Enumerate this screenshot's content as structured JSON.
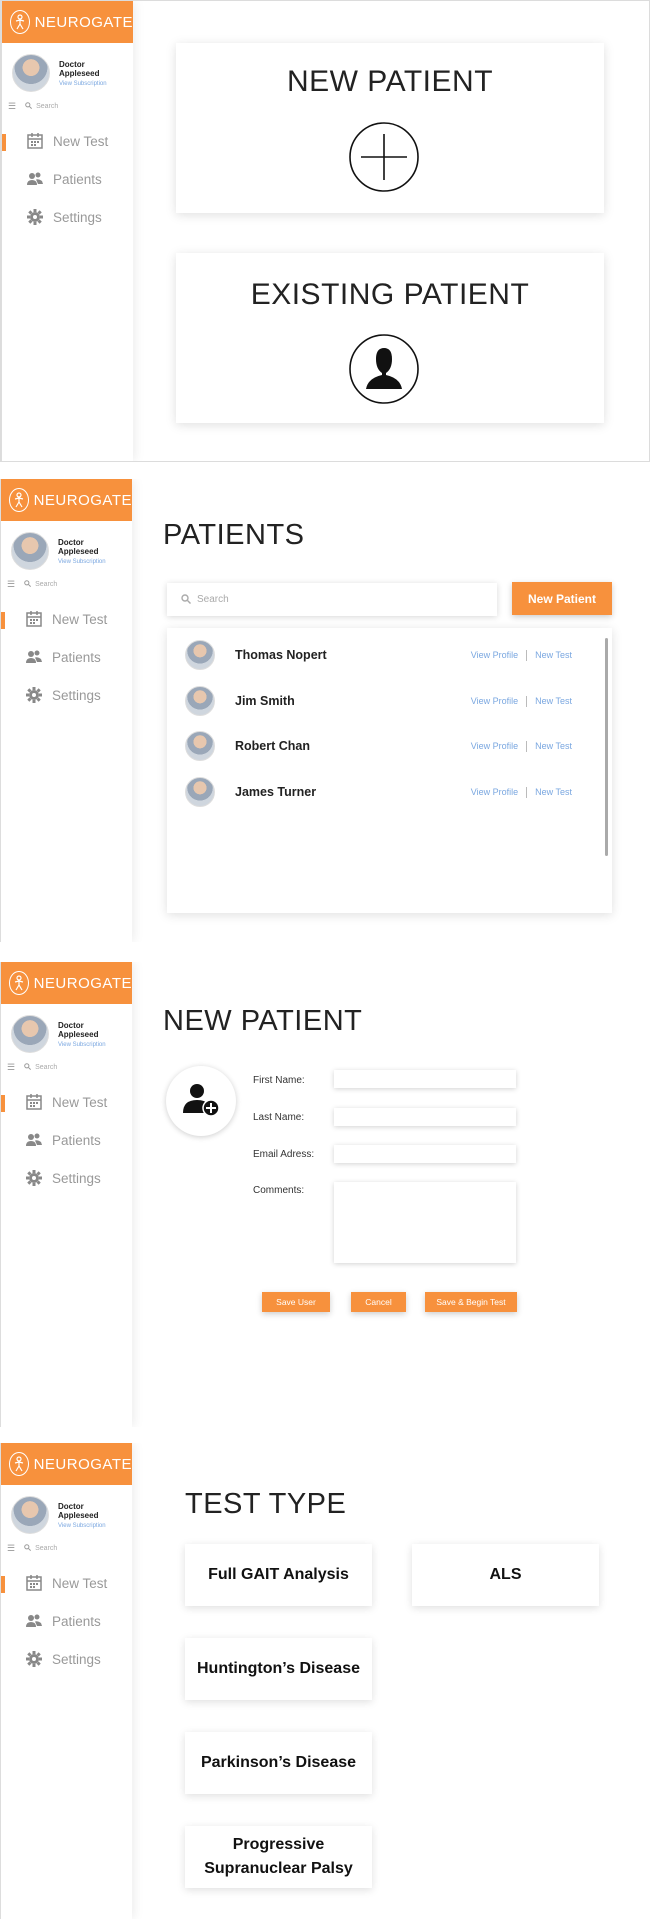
{
  "app": {
    "brand": "NEUROGATE",
    "user_name": "Doctor Appleseed",
    "user_sub": "View Subscription",
    "search_placeholder": "Search",
    "nav": [
      {
        "label": "New Test",
        "icon": "calendar-icon"
      },
      {
        "label": "Patients",
        "icon": "users-icon"
      },
      {
        "label": "Settings",
        "icon": "gear-icon"
      }
    ],
    "accent": "#f7913d",
    "link_color": "#7aa7e0"
  },
  "screen1": {
    "new_patient": "NEW PATIENT",
    "existing_patient": "EXISTING PATIENT"
  },
  "screen2": {
    "title": "PATIENTS",
    "search_placeholder": "Search",
    "new_patient_button": "New Patient",
    "patients": [
      {
        "name": "Thomas Nopert",
        "view": "View Profile",
        "test": "New Test"
      },
      {
        "name": "Jim Smith",
        "view": "View Profile",
        "test": "New Test"
      },
      {
        "name": "Robert Chan",
        "view": "View Profile",
        "test": "New Test"
      },
      {
        "name": "James Turner",
        "view": "View Profile",
        "test": "New Test"
      }
    ]
  },
  "screen3": {
    "title": "NEW PATIENT",
    "first_name": "First Name:",
    "last_name": "Last Name:",
    "email": "Email Adress:",
    "comments": "Comments:",
    "save_user": "Save User",
    "cancel": "Cancel",
    "save_begin": "Save & Begin Test"
  },
  "screen4": {
    "title": "TEST TYPE",
    "tests": [
      "Full GAIT Analysis",
      "ALS",
      "Huntington’s Disease",
      "Parkinson’s Disease",
      "Progressive Supranuclear Palsy"
    ]
  }
}
